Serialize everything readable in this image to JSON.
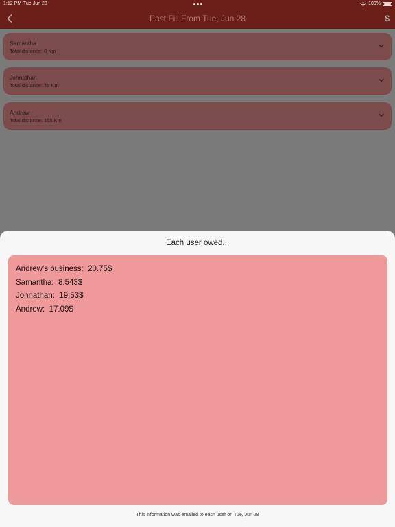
{
  "status_bar": {
    "time": "1:12 PM",
    "date": "Tue Jun 28",
    "battery": "100%",
    "icons": [
      "wifi-icon",
      "battery-icon"
    ]
  },
  "nav": {
    "title": "Past Fill From Tue, Jun 28",
    "back_icon": "chevron-left-icon",
    "dollar_label": "$"
  },
  "users": [
    {
      "name": "Samantha",
      "distance": "Total distance: 0 Km"
    },
    {
      "name": "Johnathan",
      "distance": "Total distance: 45 Km"
    },
    {
      "name": "Andrew",
      "distance": "Total distance: 155 Km"
    }
  ],
  "sheet": {
    "title": "Each user owed...",
    "lines": [
      "Andrew's business:  20.75$",
      "Samantha:  8.543$",
      "Johnathan:  19.53$",
      "Andrew:  17.09$"
    ],
    "footer": "This information was emailed to each user on Tue, Jun 28"
  },
  "colors": {
    "nav_background": "#6b1f19",
    "card_background": "#7c4c4c",
    "owed_box": "#ef9a9a",
    "sheet_background": "#f7f7f7"
  }
}
